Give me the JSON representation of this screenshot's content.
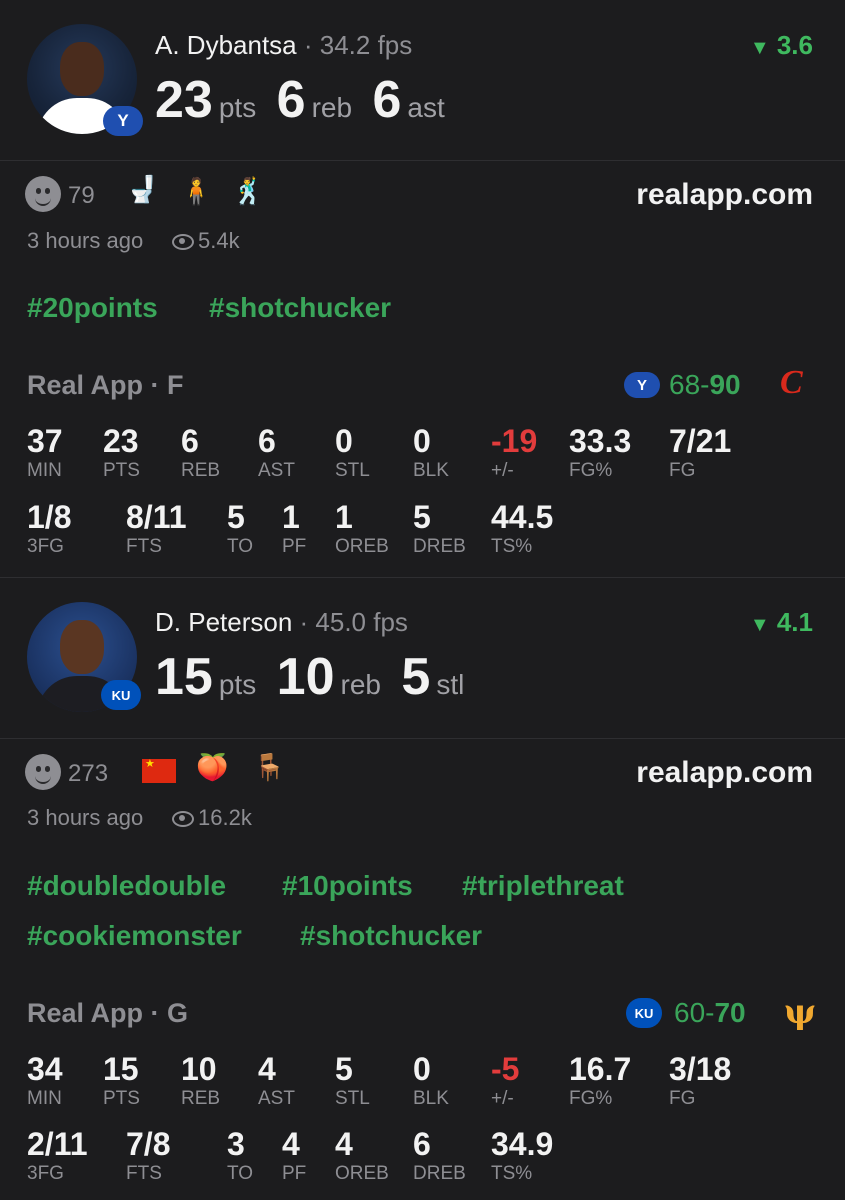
{
  "posts": [
    {
      "player": {
        "name": "A. Dybantsa",
        "separator": " · ",
        "fps": "34.2 fps",
        "stats": [
          {
            "value": "23",
            "unit": "pts"
          },
          {
            "value": "6",
            "unit": "reb"
          },
          {
            "value": "6",
            "unit": "ast"
          }
        ],
        "trend": "3.6",
        "team_badge": "Y",
        "team_color": "#1f4fb0"
      },
      "reactions": {
        "count": "79",
        "icons": [
          "smiley-icon",
          "toilet-icon",
          "person-icon",
          "person-icon"
        ]
      },
      "site": "realapp.com",
      "time": "3 hours ago",
      "views": "5.4k",
      "tags": [
        "#20points",
        "#shotchucker"
      ],
      "game": {
        "label": "Real App · F",
        "team_logo": "Y",
        "score_left": "68",
        "score_dash": "-",
        "score_right": "90",
        "opp_logo": "C",
        "opp_color": "#d9291c"
      },
      "box_row1": [
        {
          "v": "37",
          "l": "MIN"
        },
        {
          "v": "23",
          "l": "PTS"
        },
        {
          "v": "6",
          "l": "REB"
        },
        {
          "v": "6",
          "l": "AST"
        },
        {
          "v": "0",
          "l": "STL"
        },
        {
          "v": "0",
          "l": "BLK"
        },
        {
          "v": "-19",
          "l": "+/-"
        },
        {
          "v": "33.3",
          "l": "FG%"
        },
        {
          "v": "7/21",
          "l": "FG"
        }
      ],
      "box_row2": [
        {
          "v": "1/8",
          "l": "3FG"
        },
        {
          "v": "8/11",
          "l": "FTS"
        },
        {
          "v": "5",
          "l": "TO"
        },
        {
          "v": "1",
          "l": "PF"
        },
        {
          "v": "1",
          "l": "OREB"
        },
        {
          "v": "5",
          "l": "DREB"
        },
        {
          "v": "44.5",
          "l": "TS%"
        }
      ]
    },
    {
      "player": {
        "name": "D. Peterson",
        "separator": " · ",
        "fps": "45.0 fps",
        "stats": [
          {
            "value": "15",
            "unit": "pts"
          },
          {
            "value": "10",
            "unit": "reb"
          },
          {
            "value": "5",
            "unit": "stl"
          }
        ],
        "trend": "4.1",
        "team_badge": "KU",
        "team_color": "#0051ba"
      },
      "reactions": {
        "count": "273",
        "icons": [
          "smiley-icon",
          "flag-icon",
          "peach-icon",
          "chair-icon"
        ]
      },
      "site": "realapp.com",
      "time": "3 hours ago",
      "views": "16.2k",
      "tags": [
        "#doubledouble",
        "#10points",
        "#triplethreat",
        "#cookiemonster",
        "#shotchucker"
      ],
      "game": {
        "label": "Real App · G",
        "team_logo": "KU",
        "score_left": "60",
        "score_dash": "-",
        "score_right": "70",
        "opp_logo": "ψ",
        "opp_color": "#f0a830"
      },
      "box_row1": [
        {
          "v": "34",
          "l": "MIN"
        },
        {
          "v": "15",
          "l": "PTS"
        },
        {
          "v": "10",
          "l": "REB"
        },
        {
          "v": "4",
          "l": "AST"
        },
        {
          "v": "5",
          "l": "STL"
        },
        {
          "v": "0",
          "l": "BLK"
        },
        {
          "v": "-5",
          "l": "+/-"
        },
        {
          "v": "16.7",
          "l": "FG%"
        },
        {
          "v": "3/18",
          "l": "FG"
        }
      ],
      "box_row2": [
        {
          "v": "2/11",
          "l": "3FG"
        },
        {
          "v": "7/8",
          "l": "FTS"
        },
        {
          "v": "3",
          "l": "TO"
        },
        {
          "v": "4",
          "l": "PF"
        },
        {
          "v": "4",
          "l": "OREB"
        },
        {
          "v": "6",
          "l": "DREB"
        },
        {
          "v": "34.9",
          "l": "TS%"
        }
      ]
    }
  ]
}
